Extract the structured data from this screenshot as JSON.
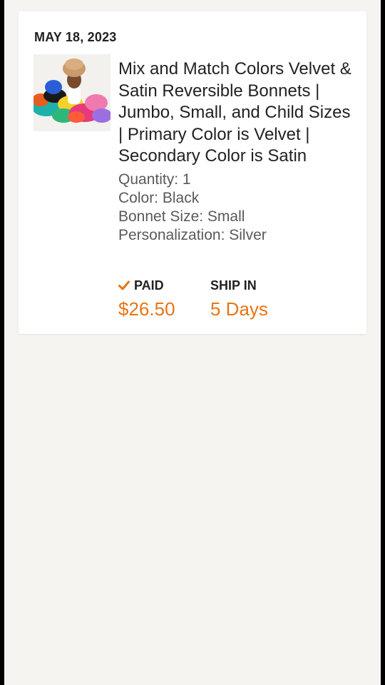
{
  "order": {
    "date": "MAY 18, 2023",
    "item_title": "Mix and Match Colors Velvet & Satin Reversible Bonnets | Jumbo, Small, and Child Sizes | Primary Color is Velvet | Secondary Color is Satin",
    "quantity": "Quantity: 1",
    "color": "Color: Black",
    "bonnet_size": "Bonnet Size: Small",
    "personalization": "Personalization: Silver",
    "paid_label": "PAID",
    "paid_value": "$26.50",
    "ship_label": "SHIP IN",
    "ship_value": "5 Days",
    "thumbnail_icon": "product-photo-bonnets"
  },
  "colors": {
    "accent": "#e87514",
    "background": "#f5f4f0",
    "card": "#ffffff",
    "text_primary": "#222222",
    "text_secondary": "#595959"
  }
}
